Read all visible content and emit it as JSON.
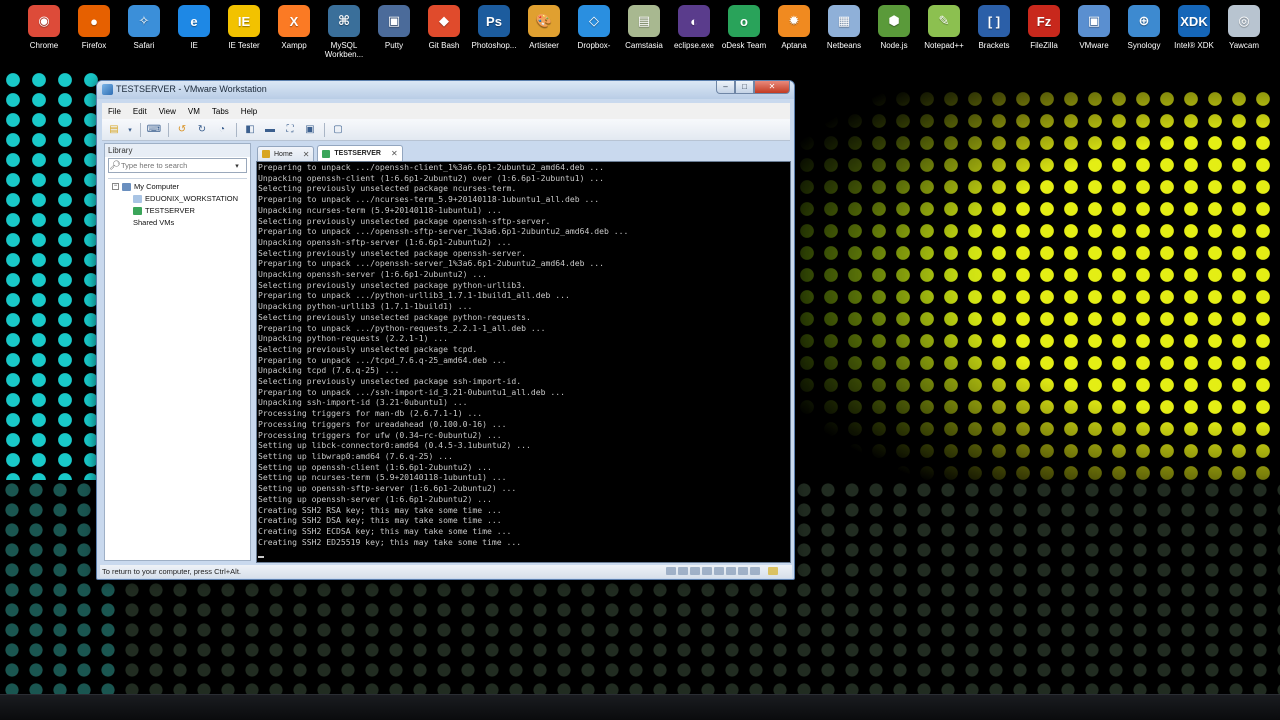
{
  "desktop": {
    "icons": [
      {
        "label": "Chrome",
        "icon": "chrome-icon",
        "color": "#dd4b39",
        "glyph": "◉"
      },
      {
        "label": "Firefox",
        "icon": "firefox-icon",
        "color": "#e66000",
        "glyph": "●"
      },
      {
        "label": "Safari",
        "icon": "safari-icon",
        "color": "#3b8fd9",
        "glyph": "✧"
      },
      {
        "label": "IE",
        "icon": "ie-icon",
        "color": "#1e88e5",
        "glyph": "e"
      },
      {
        "label": "IE Tester",
        "icon": "ie-tester-icon",
        "color": "#f2c200",
        "glyph": "IE"
      },
      {
        "label": "Xampp",
        "icon": "xampp-icon",
        "color": "#fb7a24",
        "glyph": "X"
      },
      {
        "label": "MySQL Workben...",
        "icon": "mysql-workbench-icon",
        "color": "#3a6f9a",
        "glyph": "⌘"
      },
      {
        "label": "Putty",
        "icon": "putty-icon",
        "color": "#4b6b9a",
        "glyph": "▣"
      },
      {
        "label": "Git Bash",
        "icon": "git-bash-icon",
        "color": "#e04b2c",
        "glyph": "◆"
      },
      {
        "label": "Photoshop...",
        "icon": "photoshop-icon",
        "color": "#1c5c9e",
        "glyph": "Ps"
      },
      {
        "label": "Artisteer",
        "icon": "artisteer-icon",
        "color": "#e0a030",
        "glyph": "🎨"
      },
      {
        "label": "Dropbox-",
        "icon": "dropbox-icon",
        "color": "#2a8fe0",
        "glyph": "◇"
      },
      {
        "label": "Camstasia",
        "icon": "camtasia-icon",
        "color": "#a8b890",
        "glyph": "▤"
      },
      {
        "label": "eclipse.exe",
        "icon": "eclipse-icon",
        "color": "#5a3c8c",
        "glyph": "◐"
      },
      {
        "label": "oDesk Team",
        "icon": "odesk-icon",
        "color": "#29a35a",
        "glyph": "o"
      },
      {
        "label": "Aptana",
        "icon": "aptana-icon",
        "color": "#f08a20",
        "glyph": "✹"
      },
      {
        "label": "Netbeans",
        "icon": "netbeans-icon",
        "color": "#8fb0d8",
        "glyph": "▦"
      },
      {
        "label": "Node.js",
        "icon": "nodejs-icon",
        "color": "#5a9a3a",
        "glyph": "⬢"
      },
      {
        "label": "Notepad++",
        "icon": "notepadpp-icon",
        "color": "#8cc050",
        "glyph": "✎"
      },
      {
        "label": "Brackets",
        "icon": "brackets-icon",
        "color": "#2b5fa8",
        "glyph": "[ ]"
      },
      {
        "label": "FileZilla",
        "icon": "filezilla-icon",
        "color": "#c8281c",
        "glyph": "Fz"
      },
      {
        "label": "VMware",
        "icon": "vmware-icon",
        "color": "#5a8fd0",
        "glyph": "▣"
      },
      {
        "label": "Synology",
        "icon": "synology-icon",
        "color": "#3d8ad0",
        "glyph": "⊕"
      },
      {
        "label": "Intel® XDK",
        "icon": "intel-xdk-icon",
        "color": "#1566b8",
        "glyph": "XDK"
      },
      {
        "label": "Yawcam",
        "icon": "yawcam-icon",
        "color": "#b8c4d0",
        "glyph": "◎"
      }
    ],
    "colors": {
      "left_dots": "#19c9c9",
      "right_dots": "#e4ee14"
    }
  },
  "window": {
    "title": "TESTSERVER - VMware Workstation",
    "menu": [
      "File",
      "Edit",
      "View",
      "VM",
      "Tabs",
      "Help"
    ],
    "library": {
      "title": "Library",
      "search_placeholder": "Type here to search",
      "tree": {
        "root": "My Computer",
        "children": [
          "EDUONIX_WORKSTATION",
          "TESTSERVER"
        ],
        "shared": "Shared VMs"
      }
    },
    "tabs": [
      {
        "label": "Home",
        "active": false
      },
      {
        "label": "TESTSERVER",
        "active": true
      }
    ],
    "console_lines": [
      "Preparing to unpack .../openssh-client_1%3a6.6p1-2ubuntu2_amd64.deb ...",
      "Unpacking openssh-client (1:6.6p1-2ubuntu2) over (1:6.6p1-2ubuntu1) ...",
      "Selecting previously unselected package ncurses-term.",
      "Preparing to unpack .../ncurses-term_5.9+20140118-1ubuntu1_all.deb ...",
      "Unpacking ncurses-term (5.9+20140118-1ubuntu1) ...",
      "Selecting previously unselected package openssh-sftp-server.",
      "Preparing to unpack .../openssh-sftp-server_1%3a6.6p1-2ubuntu2_amd64.deb ...",
      "Unpacking openssh-sftp-server (1:6.6p1-2ubuntu2) ...",
      "Selecting previously unselected package openssh-server.",
      "Preparing to unpack .../openssh-server_1%3a6.6p1-2ubuntu2_amd64.deb ...",
      "Unpacking openssh-server (1:6.6p1-2ubuntu2) ...",
      "Selecting previously unselected package python-urllib3.",
      "Preparing to unpack .../python-urllib3_1.7.1-1build1_all.deb ...",
      "Unpacking python-urllib3 (1.7.1-1build1) ...",
      "Selecting previously unselected package python-requests.",
      "Preparing to unpack .../python-requests_2.2.1-1_all.deb ...",
      "Unpacking python-requests (2.2.1-1) ...",
      "Selecting previously unselected package tcpd.",
      "Preparing to unpack .../tcpd_7.6.q-25_amd64.deb ...",
      "Unpacking tcpd (7.6.q-25) ...",
      "Selecting previously unselected package ssh-import-id.",
      "Preparing to unpack .../ssh-import-id_3.21-0ubuntu1_all.deb ...",
      "Unpacking ssh-import-id (3.21-0ubuntu1) ...",
      "Processing triggers for man-db (2.6.7.1-1) ...",
      "Processing triggers for ureadahead (0.100.0-16) ...",
      "Processing triggers for ufw (0.34~rc-0ubuntu2) ...",
      "Setting up libck-connector0:amd64 (0.4.5-3.1ubuntu2) ...",
      "Setting up libwrap0:amd64 (7.6.q-25) ...",
      "Setting up openssh-client (1:6.6p1-2ubuntu2) ...",
      "Setting up ncurses-term (5.9+20140118-1ubuntu1) ...",
      "Setting up openssh-sftp-server (1:6.6p1-2ubuntu2) ...",
      "Setting up openssh-server (1:6.6p1-2ubuntu2) ...",
      "Creating SSH2 RSA key; this may take some time ...",
      "Creating SSH2 DSA key; this may take some time ...",
      "Creating SSH2 ECDSA key; this may take some time ...",
      "Creating SSH2 ED25519 key; this may take some time ..."
    ],
    "status_text": "To return to your computer, press Ctrl+Alt."
  }
}
